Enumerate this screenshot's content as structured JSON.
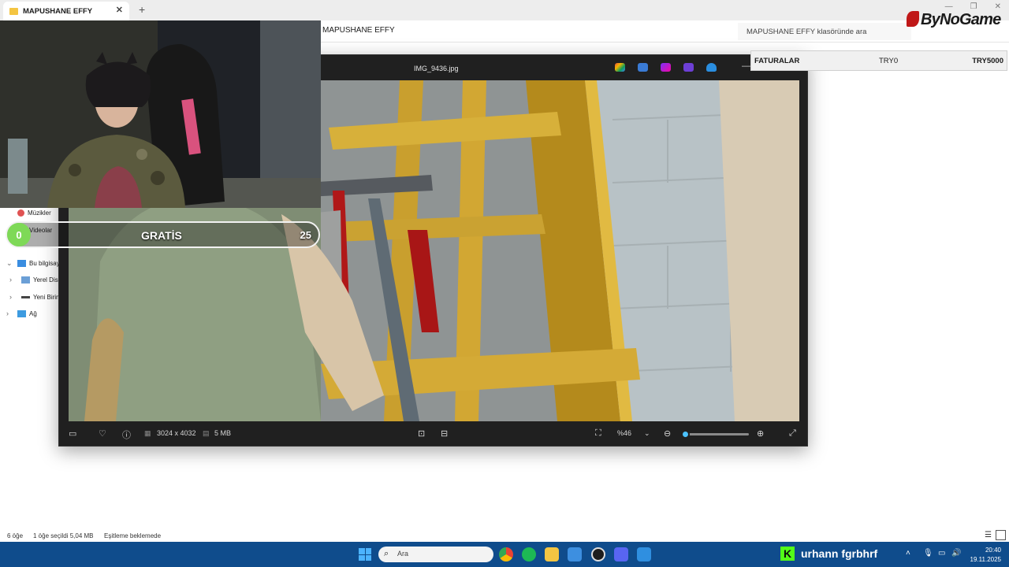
{
  "explorer": {
    "tab_title": "MAPUSHANE EFFY",
    "path": "MAPUSHANE EFFY",
    "search_placeholder": "MAPUSHANE EFFY klasöründe ara",
    "nav": {
      "music": "Müzikler",
      "videos": "Videolar",
      "this_pc": "Bu bilgisay",
      "local_disk": "Yerel Disk",
      "new_volume": "Yeni Birim",
      "network": "Ağ"
    },
    "status": {
      "items": "6 öğe",
      "selected": "1 öğe seçildi  5,04 MB",
      "sync": "Eşitleme beklemede"
    }
  },
  "overlay": {
    "brand": "ByNoGame",
    "invoice": {
      "label": "FATURALAR",
      "min": "TRY0",
      "max": "TRY5000"
    },
    "gratis": {
      "start": "0",
      "label": "GRATİS",
      "end": "25",
      "progress": 0.0
    }
  },
  "viewer": {
    "filename": "IMG_9436.jpg",
    "dimensions": "3024 x 4032",
    "filesize": "5 MB",
    "zoom": "%46",
    "zoom_level": 0.05
  },
  "taskbar": {
    "search_placeholder": "Ara",
    "kick_user": "urhann  fgrbhrf",
    "time": "20:40",
    "date": "19.11.2025"
  },
  "colors": {
    "accent": "#4cc2ff",
    "taskbar": "#0f4c8c",
    "kick": "#53fc18",
    "gratis_start": "#7ed957"
  }
}
